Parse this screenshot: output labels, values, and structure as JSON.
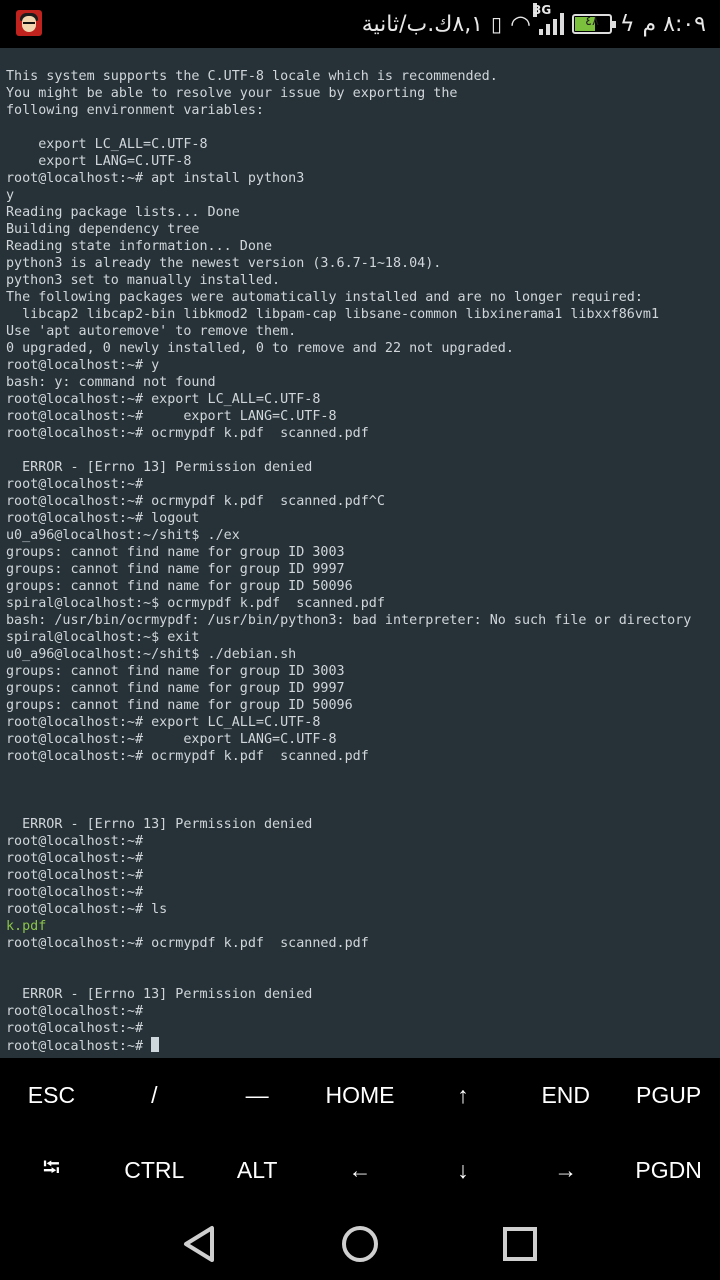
{
  "status_bar": {
    "time": "٨:٠٩ م",
    "battery_level": "٤٨",
    "network_type": "3G",
    "net_speed": "٨,١ك.ب/ثانية",
    "battery_color": "#7cc13d"
  },
  "terminal": {
    "background": "#263238",
    "lines": [
      {
        "text": "This system supports the C.UTF-8 locale which is recommended."
      },
      {
        "text": "You might be able to resolve your issue by exporting the"
      },
      {
        "text": "following environment variables:"
      },
      {
        "text": ""
      },
      {
        "text": "    export LC_ALL=C.UTF-8"
      },
      {
        "text": "    export LANG=C.UTF-8"
      },
      {
        "text": "root@localhost:~# apt install python3"
      },
      {
        "text": "y"
      },
      {
        "text": "Reading package lists... Done"
      },
      {
        "text": "Building dependency tree"
      },
      {
        "text": "Reading state information... Done"
      },
      {
        "text": "python3 is already the newest version (3.6.7-1~18.04)."
      },
      {
        "text": "python3 set to manually installed."
      },
      {
        "text": "The following packages were automatically installed and are no longer required:"
      },
      {
        "text": "  libcap2 libcap2-bin libkmod2 libpam-cap libsane-common libxinerama1 libxxf86vm1"
      },
      {
        "text": "Use 'apt autoremove' to remove them."
      },
      {
        "text": "0 upgraded, 0 newly installed, 0 to remove and 22 not upgraded."
      },
      {
        "text": "root@localhost:~# y"
      },
      {
        "text": "bash: y: command not found"
      },
      {
        "text": "root@localhost:~# export LC_ALL=C.UTF-8"
      },
      {
        "text": "root@localhost:~#     export LANG=C.UTF-8"
      },
      {
        "text": "root@localhost:~# ocrmypdf k.pdf  scanned.pdf"
      },
      {
        "text": ""
      },
      {
        "text": "  ERROR - [Errno 13] Permission denied"
      },
      {
        "text": "root@localhost:~#"
      },
      {
        "text": "root@localhost:~# ocrmypdf k.pdf  scanned.pdf^C"
      },
      {
        "text": "root@localhost:~# logout"
      },
      {
        "text": "u0_a96@localhost:~/shit$ ./ex"
      },
      {
        "text": "groups: cannot find name for group ID 3003"
      },
      {
        "text": "groups: cannot find name for group ID 9997"
      },
      {
        "text": "groups: cannot find name for group ID 50096"
      },
      {
        "text": "spiral@localhost:~$ ocrmypdf k.pdf  scanned.pdf"
      },
      {
        "text": "bash: /usr/bin/ocrmypdf: /usr/bin/python3: bad interpreter: No such file or directory"
      },
      {
        "text": "spiral@localhost:~$ exit"
      },
      {
        "text": "u0_a96@localhost:~/shit$ ./debian.sh"
      },
      {
        "text": "groups: cannot find name for group ID 3003"
      },
      {
        "text": "groups: cannot find name for group ID 9997"
      },
      {
        "text": "groups: cannot find name for group ID 50096"
      },
      {
        "text": "root@localhost:~# export LC_ALL=C.UTF-8"
      },
      {
        "text": "root@localhost:~#     export LANG=C.UTF-8"
      },
      {
        "text": "root@localhost:~# ocrmypdf k.pdf  scanned.pdf"
      },
      {
        "text": ""
      },
      {
        "text": ""
      },
      {
        "text": ""
      },
      {
        "text": "  ERROR - [Errno 13] Permission denied"
      },
      {
        "text": "root@localhost:~#"
      },
      {
        "text": "root@localhost:~#"
      },
      {
        "text": "root@localhost:~#"
      },
      {
        "text": "root@localhost:~#"
      },
      {
        "text": "root@localhost:~# ls"
      },
      {
        "text": "k.pdf",
        "color": "green"
      },
      {
        "text": "root@localhost:~# ocrmypdf k.pdf  scanned.pdf"
      },
      {
        "text": ""
      },
      {
        "text": ""
      },
      {
        "text": "  ERROR - [Errno 13] Permission denied"
      },
      {
        "text": "root@localhost:~#"
      },
      {
        "text": "root@localhost:~#"
      }
    ],
    "prompt": "root@localhost:~# "
  },
  "extra_keys": {
    "row1": [
      "ESC",
      "/",
      "―",
      "HOME",
      "↑",
      "END",
      "PGUP"
    ],
    "row2": [
      "⭾",
      "CTRL",
      "ALT",
      "←",
      "↓",
      "→",
      "PGDN"
    ]
  },
  "nav_bar": {
    "icons": [
      "back-icon",
      "home-icon",
      "recents-icon"
    ]
  }
}
